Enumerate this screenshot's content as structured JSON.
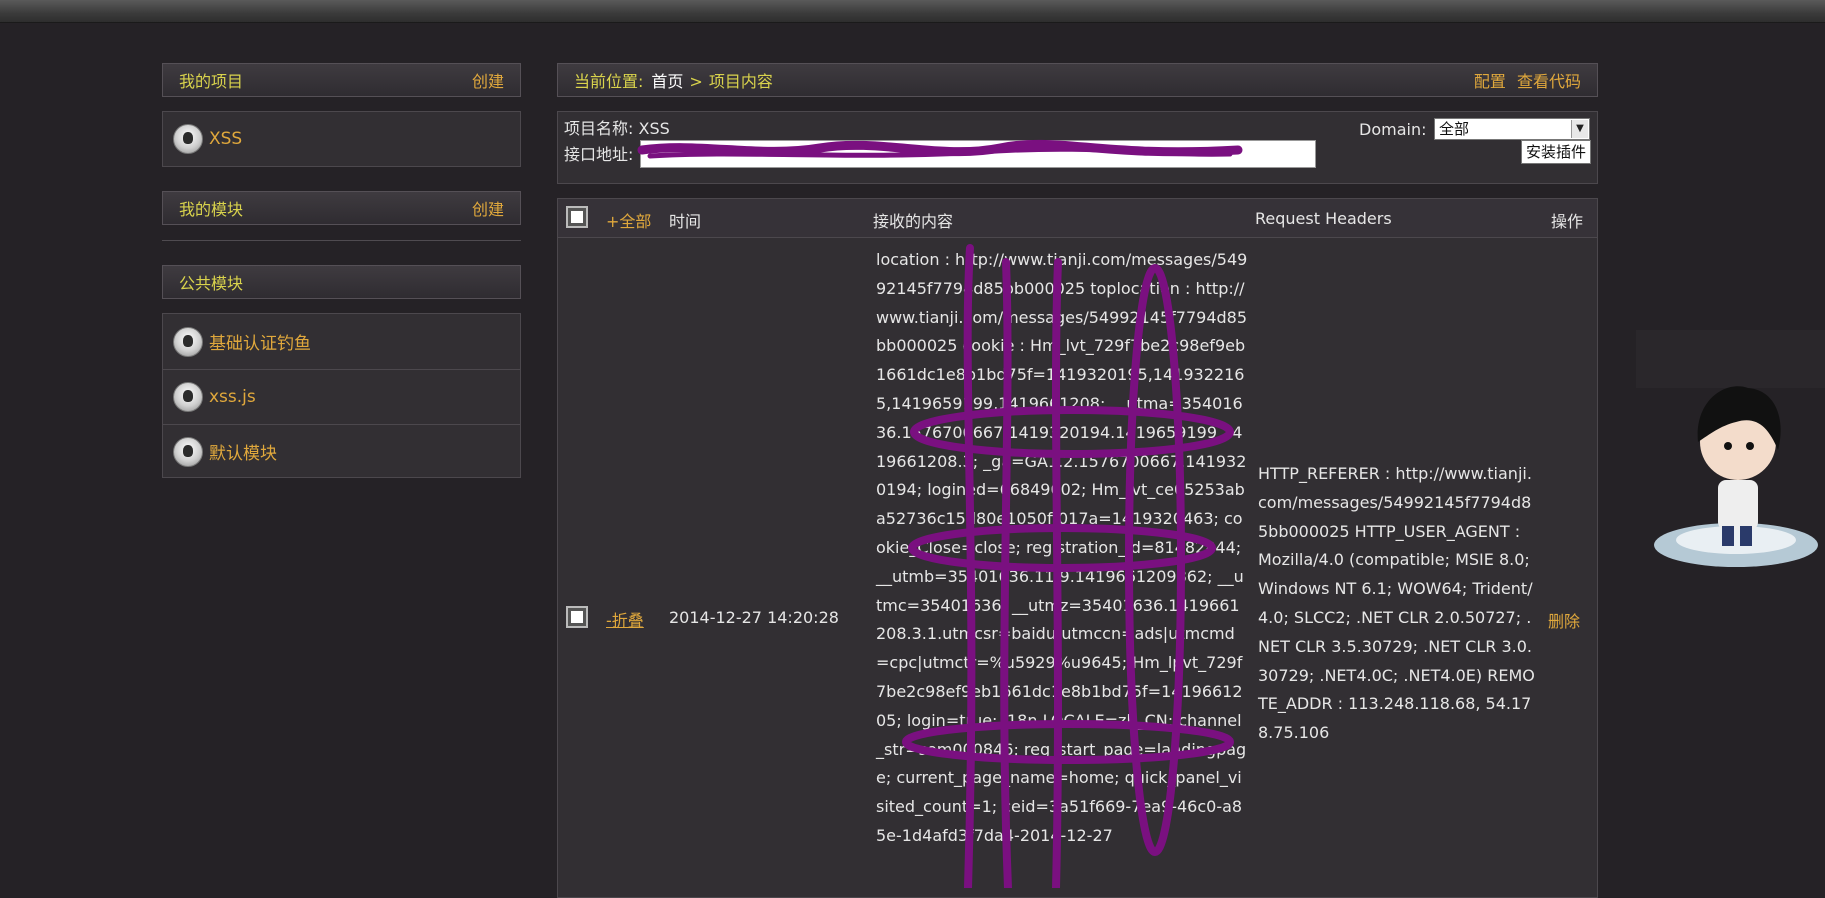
{
  "sidebar": {
    "my_projects": {
      "title": "我的项目",
      "action": "创建",
      "items": [
        {
          "label": "XSS"
        }
      ]
    },
    "my_modules": {
      "title": "我的模块",
      "action": "创建"
    },
    "public_modules": {
      "title": "公共模块",
      "items": [
        {
          "label": "基础认证钓鱼"
        },
        {
          "label": "xss.js"
        },
        {
          "label": "默认模块"
        }
      ]
    }
  },
  "breadcrumb": {
    "label": "当前位置:",
    "home": "首页",
    "separator": ">",
    "current": "项目内容",
    "config": "配置",
    "view_code": "查看代码"
  },
  "project": {
    "name_label": "项目名称:",
    "name": "XSS",
    "api_label": "接口地址:",
    "api_value": ""
  },
  "domain": {
    "label": "Domain:",
    "selected": "全部"
  },
  "install_button": "安装插件",
  "table": {
    "headers": {
      "all": "+全部",
      "time": "时间",
      "content": "接收的内容",
      "request_headers": "Request Headers",
      "actions": "操作"
    },
    "rows": [
      {
        "toggle": "-折叠",
        "time": "2014-12-27 14:20:28",
        "content": "location : http://www.tianji.com/messages/54992145f7794d85bb000025 toplocation : http://www.tianji.com/messages/54992145f7794d85bb000025 cookie : Hm_lvt_729f7be2c98ef9eb1661dc1e8b1bd75f=1419320195,1419322165,1419659199,1419661208; __utma=35401636.1576700667.1419320194.1419659199.1419661208.3; _ga=GA1.2.1576700667.1419320194; logined=66849002; Hm_lvt_ce05253aba52736c15d80e1050ff017a=1419320463; cookie_Close=close; registration_id=81482844; __utmb=35401636.11.9.1419661209862; __utmc=35401636; __utmz=35401636.1419661208.3.1.utmcsr=baidu|utmccn=ads|utmcmd=cpc|utmctr=%u5929%u9645; Hm_lpvt_729f7be2c98ef9eb1661dc1e8b1bd75f=1419661205; login=true; i18n.LOCALE=zh_CN; channel_str=sem000846; reg_start_page=landingpage; current_page_name=home; quick_panel_visited_count=1; ceid=3a51f669-7ea9-46c0-a85e-1d4afd3f7da4-2014-12-27",
        "headers": "HTTP_REFERER : http://www.tianji.com/messages/54992145f7794d85bb000025 HTTP_USER_AGENT : Mozilla/4.0 (compatible; MSIE 8.0; Windows NT 6.1; WOW64; Trident/4.0; SLCC2; .NET CLR 2.0.50727; .NET CLR 3.5.30729; .NET CLR 3.0.30729; .NET4.0C; .NET4.0E) REMOTE_ADDR : 113.248.118.68, 54.178.75.106",
        "action": "删除"
      }
    ]
  },
  "icons": {
    "module_avatar": "skull-avatar-icon",
    "checkbox": "checkbox-icon",
    "select_arrow": "triangle-down-icon"
  },
  "colors": {
    "background": "#252226",
    "accent_yellow": "#d9d34c",
    "link_orange": "#e0a83c",
    "redaction_purple": "#7a1080"
  }
}
